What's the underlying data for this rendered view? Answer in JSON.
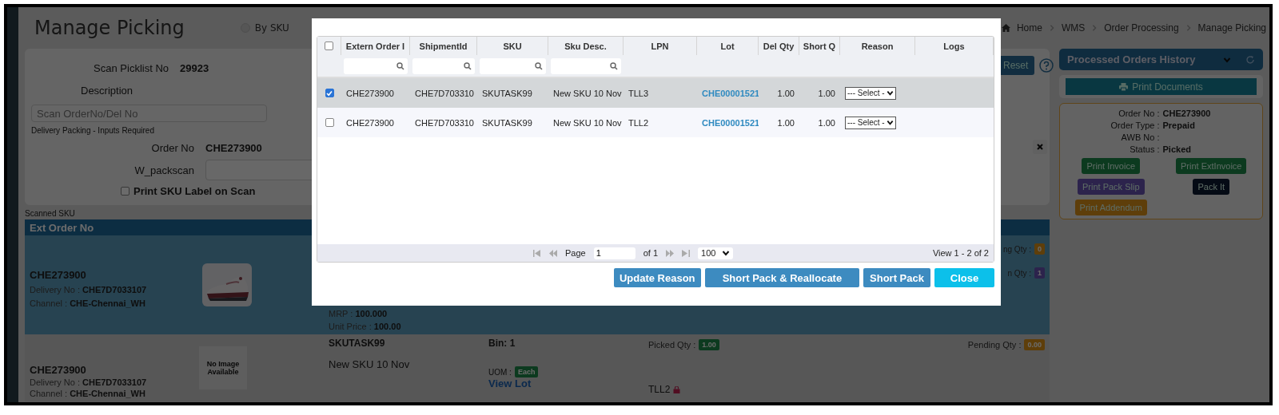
{
  "page": {
    "title": "Manage Picking",
    "mode_option": {
      "label": "By SKU",
      "selected": false
    },
    "breadcrumb": [
      "Home",
      "WMS",
      "Order Processing",
      "Manage Picking"
    ]
  },
  "scan_form": {
    "picklist_label": "Scan Picklist No",
    "picklist_value": "29923",
    "description_label": "Description",
    "order_scan_placeholder": "Scan OrderNo/Del No",
    "reset_button": "Reset"
  },
  "delivery_packing": {
    "legend": "Delivery Packing - Inputs Required",
    "order_label": "Order No",
    "order_value": "CHE273900",
    "packscan_label": "W_packscan",
    "print_label": {
      "label": "Print SKU Label on Scan",
      "checked": false
    }
  },
  "scanned_sku": {
    "legend": "Scanned SKU",
    "header": "Ext Order No",
    "orders": [
      {
        "selected": true,
        "order_no": "CHE273900",
        "delivery_label": "Delivery No :",
        "delivery_no": "CHE7D7033107",
        "channel_label": "Channel :",
        "channel": "CHE-Chennai_WH",
        "mrp_label": "MRP :",
        "mrp": "100.000",
        "unit_price_label": "Unit Price :",
        "unit_price": "100.00",
        "qty": [
          {
            "label": "ng Qty :",
            "value": "0",
            "kind": "warning"
          },
          {
            "label": "n Qty :",
            "value": "1",
            "kind": "purple"
          }
        ]
      },
      {
        "selected": false,
        "order_no": "CHE273900",
        "delivery_label": "Delivery No :",
        "delivery_no": "CHE7D7033107",
        "channel_label": "Channel :",
        "channel": "CHE-Chennai_WH",
        "image": {
          "kind": "placeholder",
          "text": "No Image Available"
        },
        "sku": "SKUTASK99",
        "bin_label": "Bin:",
        "bin": "1",
        "description": "New SKU 10 Nov",
        "uom_label": "UOM :",
        "uom": "Each",
        "view_lot": "View Lot",
        "lpn": "TLL2",
        "picked_label": "Picked Qty :",
        "picked": "1.00",
        "pending_label": "Pending Qty :",
        "pending": "0.00"
      }
    ]
  },
  "history": {
    "title": "Processed Orders History",
    "print_documents": "Print Documents",
    "details": [
      {
        "label": "Order No :",
        "value": "CHE273900"
      },
      {
        "label": "Order Type :",
        "value": "Prepaid"
      },
      {
        "label": "AWB No :"
      },
      {
        "label": "Status :",
        "value": "Picked"
      }
    ],
    "actions": [
      {
        "label": "Print Invoice",
        "kind": "success"
      },
      {
        "label": "Print ExtInvoice",
        "kind": "success"
      },
      {
        "label": "Print Pack Slip",
        "kind": "purple"
      },
      {
        "label": "Pack It",
        "kind": "dark"
      },
      {
        "label": "Print Addendum",
        "kind": "warning"
      }
    ]
  },
  "dialog": {
    "select_all": {
      "checked": false
    },
    "columns": [
      {
        "label": "Extern Order I",
        "filter": true
      },
      {
        "label": "ShipmentId",
        "filter": true
      },
      {
        "label": "SKU",
        "filter": true
      },
      {
        "label": "Sku Desc.",
        "filter": true
      },
      {
        "label": "LPN",
        "filter": false
      },
      {
        "label": "Lot",
        "filter": false
      },
      {
        "label": "Del Qty",
        "filter": false
      },
      {
        "label": "Short Q",
        "filter": false
      },
      {
        "label": "Reason",
        "filter": false
      },
      {
        "label": "Logs",
        "filter": false
      }
    ],
    "rows": [
      {
        "selected": true,
        "checked": true,
        "cells": [
          "CHE273900",
          "CHE7D703310",
          "SKUTASK99",
          "New SKU 10 Nov",
          "TLL3",
          "CHE00001521",
          "1.00",
          "1.00"
        ],
        "reason": "--- Select -"
      },
      {
        "selected": false,
        "checked": false,
        "cells": [
          "CHE273900",
          "CHE7D703310",
          "SKUTASK99",
          "New SKU 10 Nov",
          "TLL2",
          "CHE00001521",
          "1.00",
          "1.00"
        ],
        "reason": "--- Select -"
      }
    ],
    "pager": {
      "page_label": "Page",
      "page": "1",
      "of": "of 1",
      "page_size": "100",
      "view": "View 1 - 2 of 2"
    },
    "buttons": [
      {
        "label": "Update Reason",
        "kind": "primary"
      },
      {
        "label": "Short Pack & Reallocate",
        "kind": "primary"
      },
      {
        "label": "Short Pack",
        "kind": "primary"
      },
      {
        "label": "Close",
        "kind": "info"
      }
    ]
  }
}
